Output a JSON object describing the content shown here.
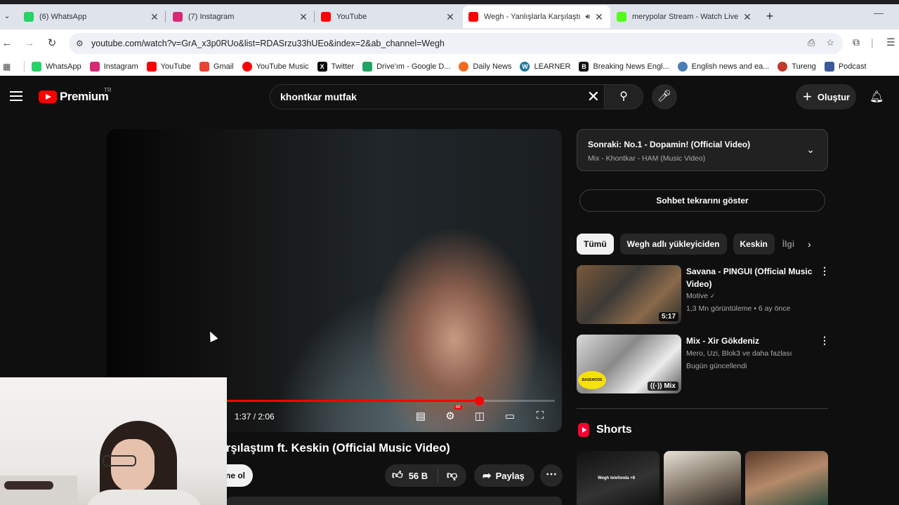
{
  "browser": {
    "tabs": [
      {
        "title": "(6) WhatsApp",
        "icon": "whatsapp-icon",
        "color": "#25d366"
      },
      {
        "title": "(7) Instagram",
        "icon": "instagram-icon",
        "color": "#d62976"
      },
      {
        "title": "YouTube",
        "icon": "youtube-icon",
        "color": "#ff0000"
      },
      {
        "title": "Wegh - Yanlışlarla Karşılaştı",
        "icon": "youtube-icon",
        "color": "#ff0000",
        "active": true
      },
      {
        "title": "merypolar Stream - Watch Live",
        "icon": "kick-icon",
        "color": "#53fc18"
      }
    ],
    "url": "youtube.com/watch?v=GrA_x3p0RUo&list=RDASrzu33hUEo&index=2&ab_channel=Wegh",
    "bookmarks": [
      {
        "label": "WhatsApp",
        "icon": "whatsapp-icon",
        "color": "#25d366"
      },
      {
        "label": "Instagram",
        "icon": "instagram-icon",
        "color": "#d62976"
      },
      {
        "label": "YouTube",
        "icon": "youtube-icon",
        "color": "#ff0000"
      },
      {
        "label": "Gmail",
        "icon": "gmail-icon",
        "color": "#ea4335"
      },
      {
        "label": "YouTube Music",
        "icon": "youtube-music-icon",
        "color": "#ff0000"
      },
      {
        "label": "Twitter",
        "icon": "x-icon",
        "color": "#000000"
      },
      {
        "label": "Drive'ım - Google D...",
        "icon": "google-drive-icon",
        "color": "#1fa463"
      },
      {
        "label": "Daily News",
        "icon": "daily-news-icon",
        "color": "#f26b1d"
      },
      {
        "label": "LEARNER",
        "icon": "wordpress-icon",
        "color": "#21759b"
      },
      {
        "label": "Breaking News Engl...",
        "icon": "b-icon",
        "color": "#111111"
      },
      {
        "label": "English news and ea...",
        "icon": "globe-icon",
        "color": "#4a7fb5"
      },
      {
        "label": "Tureng",
        "icon": "tureng-icon",
        "color": "#c0392b"
      },
      {
        "label": "Podcast",
        "icon": "podcast-icon",
        "color": "#3b5998"
      }
    ]
  },
  "youtube": {
    "logo_text": "Premium",
    "country": "TR",
    "search_value": "khontkar mutfak",
    "create_label": "Oluştur",
    "player": {
      "time": "1:37 / 2:06",
      "progress": 0.77,
      "quality_badge": "4K"
    },
    "video_title": "rşılaştım ft. Keskin (Official Music Video)",
    "subscribe_label": "ne ol",
    "likes": "56 B",
    "share_label": "Paylaş",
    "up_next": {
      "title": "Sonraki: No.1 - Dopamin! (Official Video)",
      "subtitle": "Mix - Khontkar - HAM (Music Video)"
    },
    "chat_replay_label": "Sohbet tekrarını göster",
    "chips": [
      "Tümü",
      "Wegh adlı yükleyiciden",
      "Keskin",
      "İlgi"
    ],
    "recommendations": [
      {
        "title": "Savana - PINGUI (Official Music Video)",
        "channel": "Motive",
        "meta": "1,3 Mn görüntüleme • 6 ay önce",
        "duration": "5:17"
      },
      {
        "title": "Mix - Xir Gökdeniz",
        "channel": "Mero, Uzi, Blok3 ve daha fazlası",
        "meta": "Bugün güncellendi",
        "duration": "Mix",
        "thumb_logo": "BASEMODE"
      }
    ],
    "shorts_title": "Shorts",
    "shorts": [
      {
        "caption": "Wegh telefonda +8"
      },
      {
        "caption": ""
      },
      {
        "caption": ""
      }
    ]
  }
}
